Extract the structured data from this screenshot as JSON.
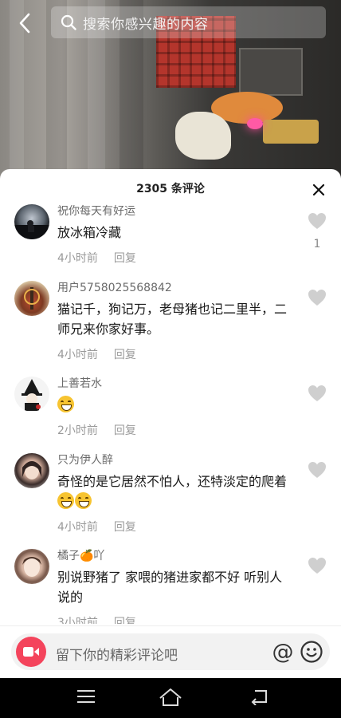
{
  "header": {
    "search_placeholder": "搜索你感兴趣的内容"
  },
  "sheet": {
    "comment_count": "2305 条评论"
  },
  "comments": [
    {
      "username": "祝你每天有好运",
      "text": "放冰箱冷藏",
      "time": "4小时前",
      "reply": "回复",
      "likes": "1",
      "emojis": 0
    },
    {
      "username": "用户5758025568842",
      "text": "猫记千，狗记万，老母猪也记二里半，二师兄来你家好事。",
      "time": "4小时前",
      "reply": "回复",
      "likes": "",
      "emojis": 0
    },
    {
      "username": "上善若水",
      "text": "",
      "time": "2小时前",
      "reply": "回复",
      "likes": "",
      "emojis": 1
    },
    {
      "username": "只为伊人醉",
      "text": "奇怪的是它居然不怕人，还特淡定的爬着",
      "time": "4小时前",
      "reply": "回复",
      "likes": "",
      "emojis": 2
    },
    {
      "username": "橘子🍊吖",
      "text": "别说野猪了 家喂的猪进家都不好 听别人说的",
      "time": "3小时前",
      "reply": "回复",
      "likes": "",
      "emojis": 0
    }
  ],
  "input": {
    "placeholder": "留下你的精彩评论吧",
    "at_symbol": "@"
  },
  "icons": {
    "back": "chevron-left-icon",
    "search": "search-icon",
    "close": "close-icon",
    "like": "heart-icon",
    "camera": "video-camera-icon",
    "emoji": "smiley-icon"
  },
  "colors": {
    "accent": "#f4445c",
    "like_gray": "#cfcfcf"
  }
}
